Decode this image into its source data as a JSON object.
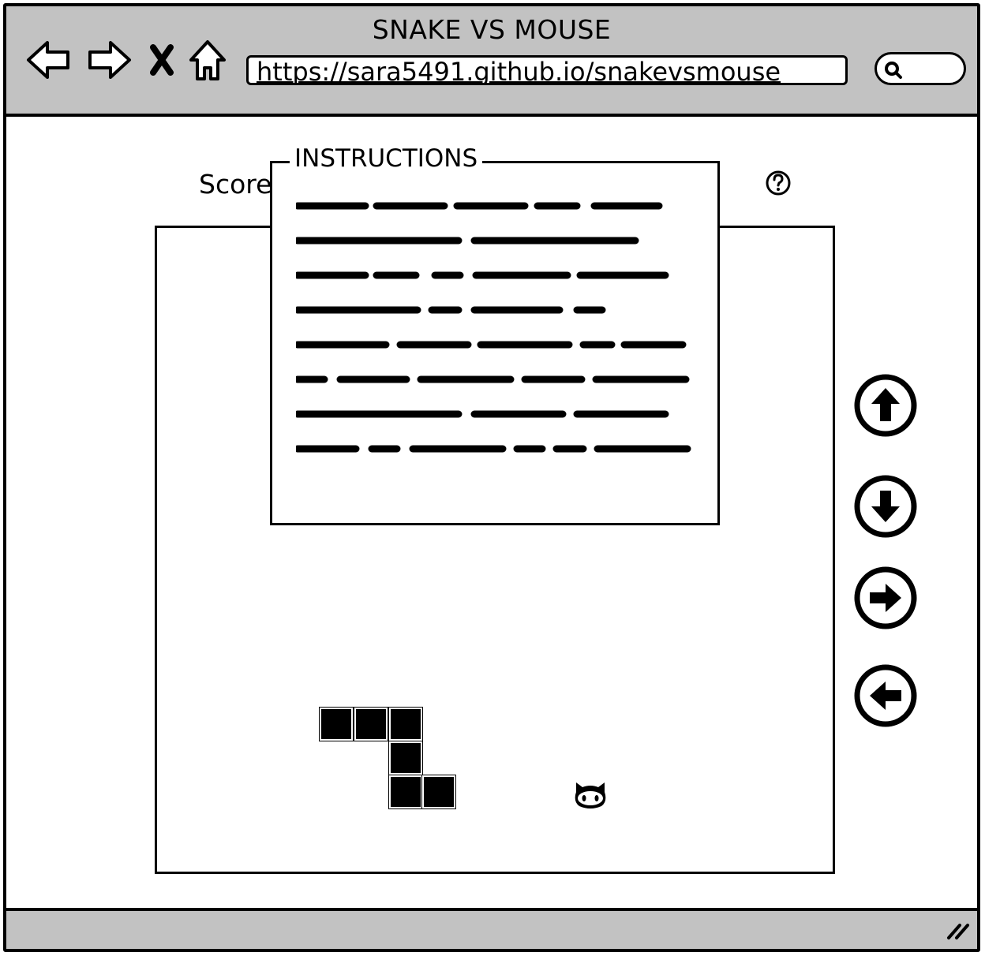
{
  "window": {
    "title": "SNAKE VS MOUSE",
    "url": "https://sara5491.github.io/snakevsmouse"
  },
  "nav": {
    "back_icon": "back-arrow-icon",
    "forward_icon": "forward-arrow-icon",
    "close_icon": "close-icon",
    "home_icon": "home-icon",
    "search_icon": "search-icon"
  },
  "game": {
    "score_label": "Score"
  },
  "instructions": {
    "title": "INSTRUCTIONS",
    "line_count": 8
  },
  "controls": [
    {
      "name": "up",
      "icon": "arrow-up-circle-icon"
    },
    {
      "name": "down",
      "icon": "arrow-down-circle-icon"
    },
    {
      "name": "right",
      "icon": "arrow-right-circle-icon"
    },
    {
      "name": "left",
      "icon": "arrow-left-circle-icon"
    }
  ],
  "colors": {
    "chrome": "#c2c2c2",
    "ink": "#000000",
    "background": "#ffffff"
  }
}
